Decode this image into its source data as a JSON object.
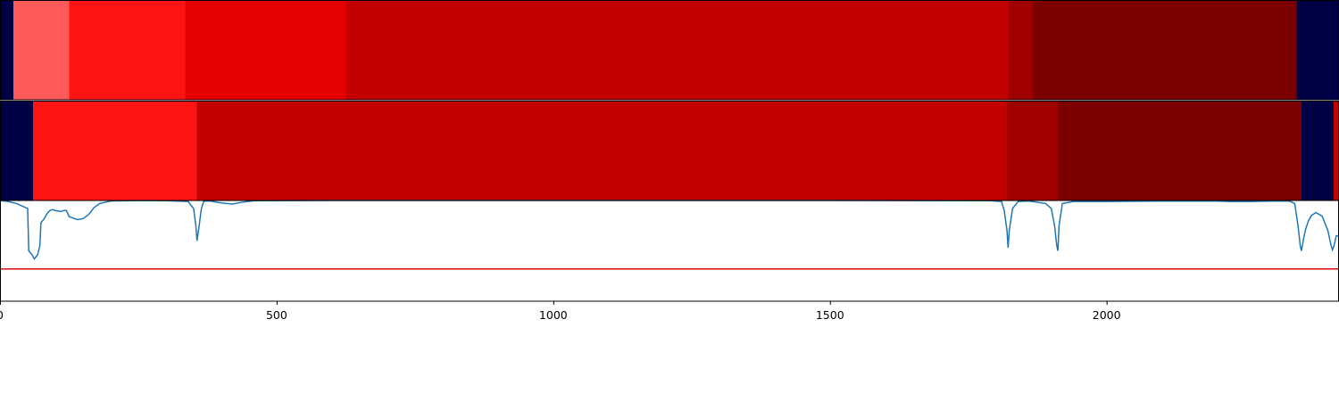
{
  "chart_data": {
    "type": "segmentation-timeline",
    "x_range": [
      0,
      2420
    ],
    "colors": {
      "navy": "#000046",
      "light_red": "#ff5a5a",
      "bright_red": "#ff1414",
      "red": "#e60000",
      "mid_red": "#c30000",
      "dark_red": "#a00000",
      "maroon": "#7d0000",
      "plot_line": "#1f77b4",
      "threshold_line": "#e31a1c"
    },
    "tracks": [
      {
        "segments": [
          {
            "start": 0,
            "end": 24,
            "color": "navy"
          },
          {
            "start": 24,
            "end": 125,
            "color": "light_red"
          },
          {
            "start": 125,
            "end": 335,
            "color": "bright_red"
          },
          {
            "start": 335,
            "end": 625,
            "color": "red"
          },
          {
            "start": 625,
            "end": 1822,
            "color": "mid_red"
          },
          {
            "start": 1822,
            "end": 1867,
            "color": "dark_red"
          },
          {
            "start": 1867,
            "end": 2343,
            "color": "maroon"
          },
          {
            "start": 2343,
            "end": 2420,
            "color": "navy"
          }
        ]
      },
      {
        "segments": [
          {
            "start": 0,
            "end": 60,
            "color": "navy"
          },
          {
            "start": 60,
            "end": 356,
            "color": "bright_red"
          },
          {
            "start": 356,
            "end": 1820,
            "color": "mid_red"
          },
          {
            "start": 1820,
            "end": 1912,
            "color": "dark_red"
          },
          {
            "start": 1912,
            "end": 2352,
            "color": "maroon"
          },
          {
            "start": 2352,
            "end": 2410,
            "color": "navy"
          },
          {
            "start": 2410,
            "end": 2420,
            "color": "mid_red"
          }
        ]
      }
    ],
    "score_plot": {
      "y_range": [
        0,
        1
      ],
      "threshold": 0.32,
      "x": [
        0,
        15,
        30,
        50,
        52,
        58,
        62,
        68,
        72,
        74,
        80,
        85,
        90,
        95,
        100,
        110,
        115,
        120,
        125,
        130,
        140,
        150,
        160,
        170,
        180,
        200,
        250,
        300,
        340,
        350,
        354,
        356,
        360,
        364,
        368,
        372,
        380,
        400,
        420,
        440,
        460,
        600,
        1000,
        1500,
        1790,
        1810,
        1815,
        1820,
        1822,
        1824,
        1830,
        1840,
        1860,
        1890,
        1900,
        1906,
        1910,
        1912,
        1914,
        1920,
        1940,
        2000,
        2100,
        2200,
        2220,
        2260,
        2300,
        2330,
        2340,
        2346,
        2350,
        2352,
        2356,
        2360,
        2365,
        2370,
        2378,
        2385,
        2390,
        2400,
        2405,
        2408,
        2411,
        2415,
        2420
      ],
      "y": [
        1.0,
        0.99,
        0.97,
        0.92,
        0.5,
        0.46,
        0.42,
        0.46,
        0.55,
        0.78,
        0.82,
        0.87,
        0.9,
        0.91,
        0.9,
        0.89,
        0.9,
        0.9,
        0.84,
        0.83,
        0.81,
        0.82,
        0.86,
        0.93,
        0.97,
        0.995,
        0.999,
        0.998,
        0.99,
        0.92,
        0.75,
        0.6,
        0.75,
        0.92,
        0.99,
        0.995,
        0.995,
        0.975,
        0.965,
        0.985,
        0.998,
        1.0,
        1.0,
        1.0,
        0.998,
        0.99,
        0.9,
        0.7,
        0.53,
        0.7,
        0.92,
        0.99,
        0.995,
        0.97,
        0.92,
        0.75,
        0.55,
        0.5,
        0.75,
        0.97,
        0.99,
        0.99,
        0.995,
        0.995,
        0.99,
        0.99,
        0.995,
        0.995,
        0.97,
        0.75,
        0.55,
        0.5,
        0.62,
        0.72,
        0.8,
        0.85,
        0.88,
        0.86,
        0.84,
        0.7,
        0.57,
        0.51,
        0.55,
        0.65,
        0.65
      ]
    },
    "xaxis": {
      "ticks": [
        0,
        500,
        1000,
        1500,
        2000
      ],
      "tick_labels": [
        "0",
        "500",
        "1000",
        "1500",
        "2000"
      ]
    }
  }
}
